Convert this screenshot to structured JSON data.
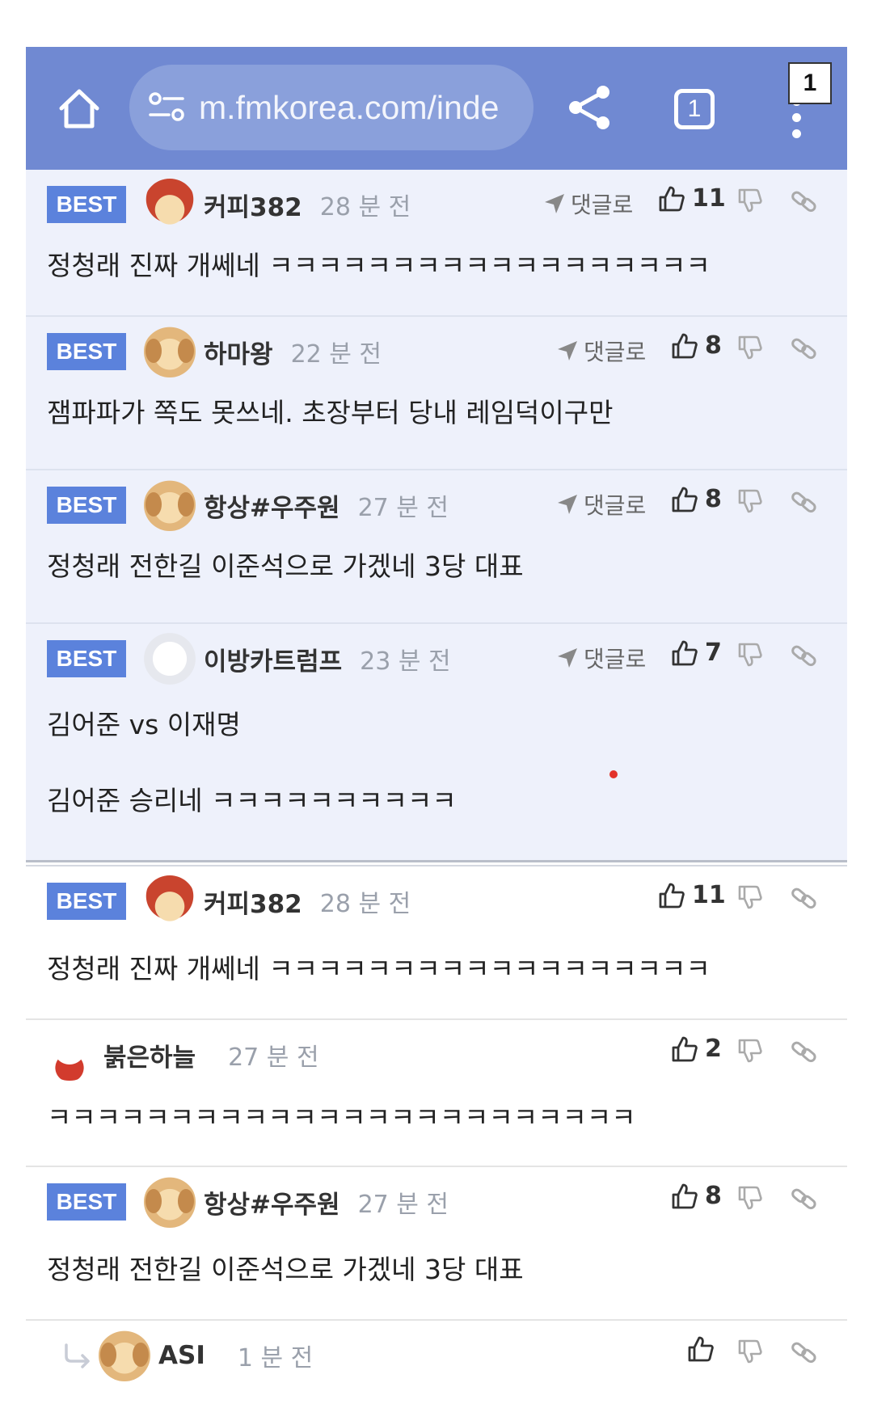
{
  "browser": {
    "url": "m.fmkorea.com/inde",
    "tab_count": "1",
    "corner_badge": "1"
  },
  "labels": {
    "best": "BEST",
    "reply": "댓글로"
  },
  "comments": [
    {
      "nick": "커피382",
      "time": "28 분 전",
      "likes": "11",
      "lines": [
        "정청래 진짜 개쎄네 ㅋㅋㅋㅋㅋㅋㅋㅋㅋㅋㅋㅋㅋㅋㅋㅋㅋㅋ"
      ]
    },
    {
      "nick": "하마왕",
      "time": "22 분 전",
      "likes": "8",
      "lines": [
        "잼파파가 쪽도 못쓰네. 초장부터 당내 레임덕이구만"
      ]
    },
    {
      "nick": "항상#우주원",
      "time": "27 분 전",
      "likes": "8",
      "lines": [
        "정청래 전한길 이준석으로 가겠네 3당 대표"
      ]
    },
    {
      "nick": "이방카트럼프",
      "time": "23 분 전",
      "likes": "7",
      "lines": [
        "김어준 vs 이재명",
        "김어준 승리네 ㅋㅋㅋㅋㅋㅋㅋㅋㅋㅋ"
      ]
    }
  ],
  "list": [
    {
      "nick": "커피382",
      "time": "28 분 전",
      "likes": "11",
      "text": "정청래 진짜 개쎄네 ㅋㅋㅋㅋㅋㅋㅋㅋㅋㅋㅋㅋㅋㅋㅋㅋㅋㅋ"
    },
    {
      "nick": "붉은하늘",
      "time": "27 분 전",
      "likes": "2",
      "text": "ㅋㅋㅋㅋㅋㅋㅋㅋㅋㅋㅋㅋㅋㅋㅋㅋㅋㅋㅋㅋㅋㅋㅋㅋ"
    },
    {
      "nick": "항상#우주원",
      "time": "27 분 전",
      "likes": "8",
      "text": "정청래 전한길 이준석으로 가겠네 3당 대표"
    },
    {
      "nick": "ASI",
      "time": "1 분 전",
      "likes": "",
      "text": ""
    }
  ],
  "icons": {
    "home": "home-icon",
    "url_settings": "site-settings-icon",
    "share": "share-icon",
    "tabs": "tabs-icon",
    "menu": "more-menu-icon",
    "like": "thumbs-up-icon",
    "dislike": "thumbs-down-icon",
    "link": "link-icon",
    "reply": "paper-plane-icon"
  },
  "colors": {
    "topbar": "#7089d2",
    "best_badge": "#5b82dc",
    "best_bg": "#eef1fb"
  }
}
